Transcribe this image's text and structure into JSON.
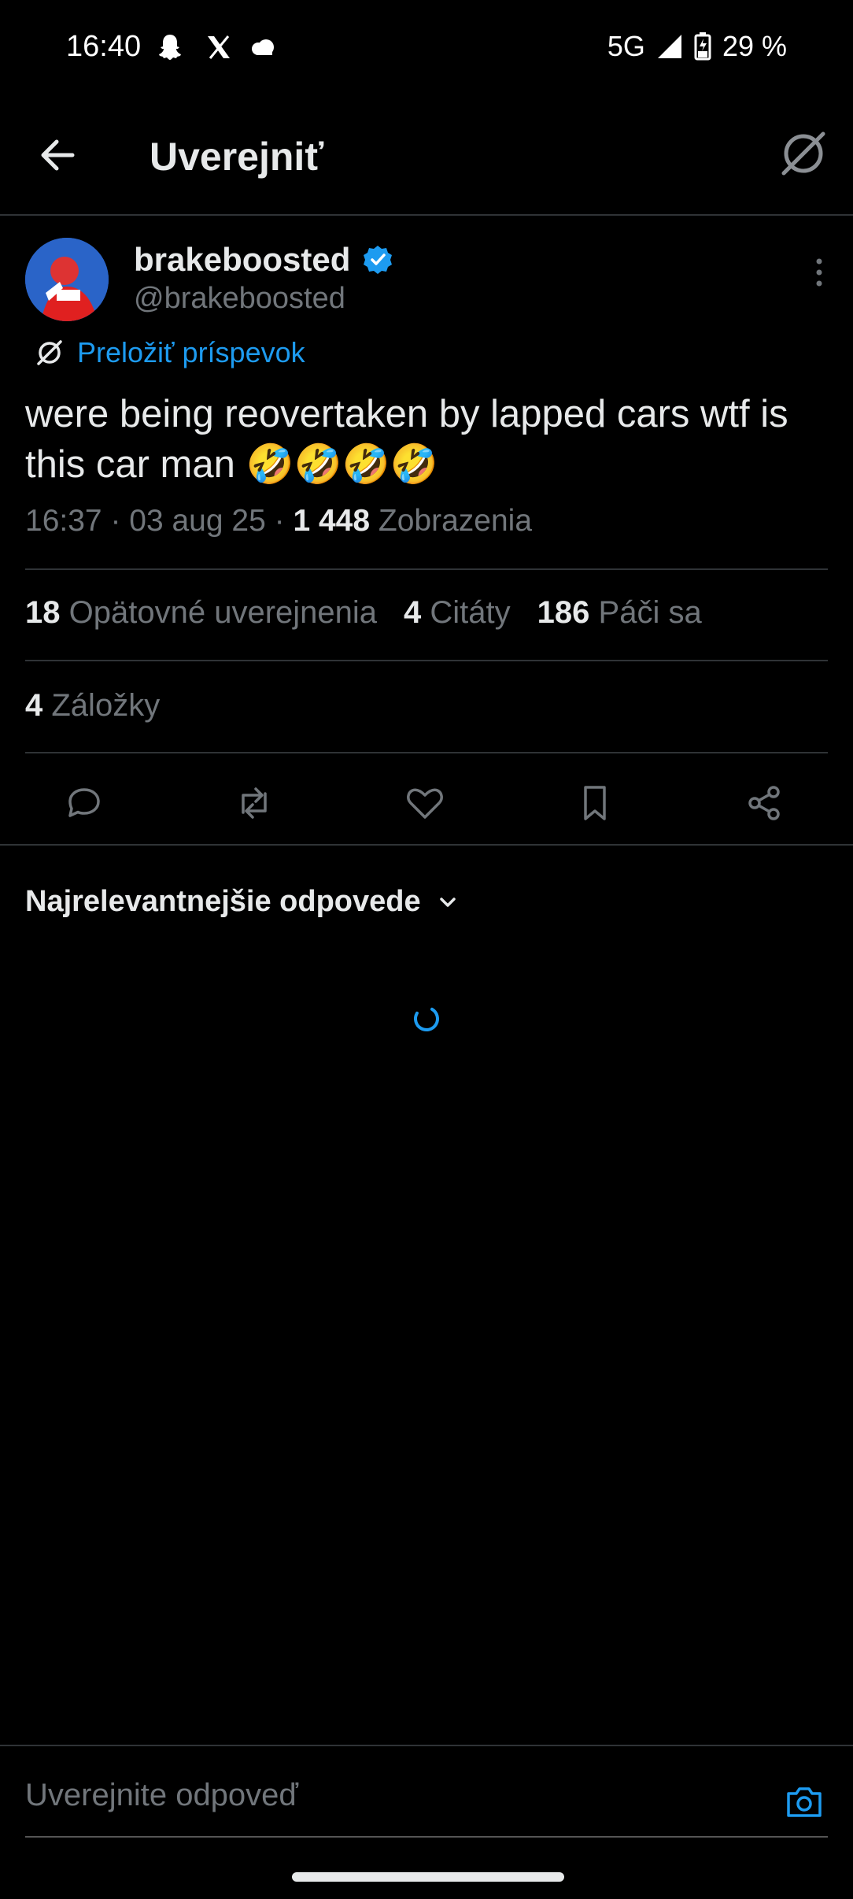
{
  "status_bar": {
    "time": "16:40",
    "network": "5G",
    "battery": "29 %",
    "icons": [
      "snapchat-icon",
      "x-icon",
      "cloud-icon",
      "signal-icon",
      "battery-icon"
    ]
  },
  "header": {
    "title": "Uverejniť",
    "back_icon": "arrow-left-icon",
    "translate_icon": "translate-icon"
  },
  "post": {
    "display_name": "brakeboosted",
    "handle": "@brakeboosted",
    "verified": true,
    "translate_label": "Preložiť príspevok",
    "text": "were being reovertaken by lapped cars wtf is this car man 🤣🤣🤣🤣",
    "time": "16:37",
    "date": "03 aug 25",
    "views": "1 448",
    "views_label": "Zobrazenia"
  },
  "stats": {
    "reposts": "18",
    "reposts_label": "Opätovné uverejnenia",
    "quotes": "4",
    "quotes_label": "Citáty",
    "likes": "186",
    "likes_label": "Páči sa",
    "bookmarks": "4",
    "bookmarks_label": "Záložky"
  },
  "actions": [
    "reply-icon",
    "repost-icon",
    "like-icon",
    "bookmark-icon",
    "share-icon"
  ],
  "replies": {
    "sort_label": "Najrelevantnejšie odpovede"
  },
  "reply_bar": {
    "placeholder": "Uverejnite odpoveď"
  },
  "colors": {
    "background": "#000000",
    "text": "#e7e9ea",
    "muted": "#71767b",
    "accent": "#1d9bf0",
    "divider": "#2f3336"
  }
}
